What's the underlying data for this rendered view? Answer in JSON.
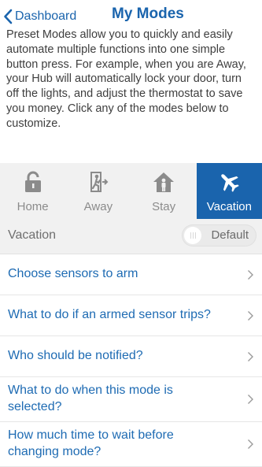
{
  "header": {
    "back_label": "Dashboard",
    "title": "My Modes"
  },
  "intro": "Preset Modes allow you to quickly and easily automate multiple functions into one simple button press. For example, when you are Away, your Hub will automatically lock your door, turn off the lights, and adjust the thermostat to save you money. Click any of the modes below to customize.",
  "modes": [
    {
      "label": "Home",
      "icon": "unlocked-padlock-icon",
      "active": false
    },
    {
      "label": "Away",
      "icon": "exit-door-icon",
      "active": false
    },
    {
      "label": "Stay",
      "icon": "house-person-icon",
      "active": false
    },
    {
      "label": "Vacation",
      "icon": "airplane-icon",
      "active": true
    }
  ],
  "selected_mode": {
    "name": "Vacation",
    "toggle_label": "Default"
  },
  "options": [
    {
      "label": "Choose sensors to arm"
    },
    {
      "label": "What to do if an armed sensor trips?"
    },
    {
      "label": "Who should be notified?"
    },
    {
      "label": "What to do when this mode is selected?"
    },
    {
      "label": "How much time to wait before changing mode?"
    }
  ],
  "colors": {
    "accent": "#1a64ad",
    "link": "#1e6bb3",
    "tab_bg": "#f1f1f1",
    "inactive_icon": "#8b8b8b"
  }
}
